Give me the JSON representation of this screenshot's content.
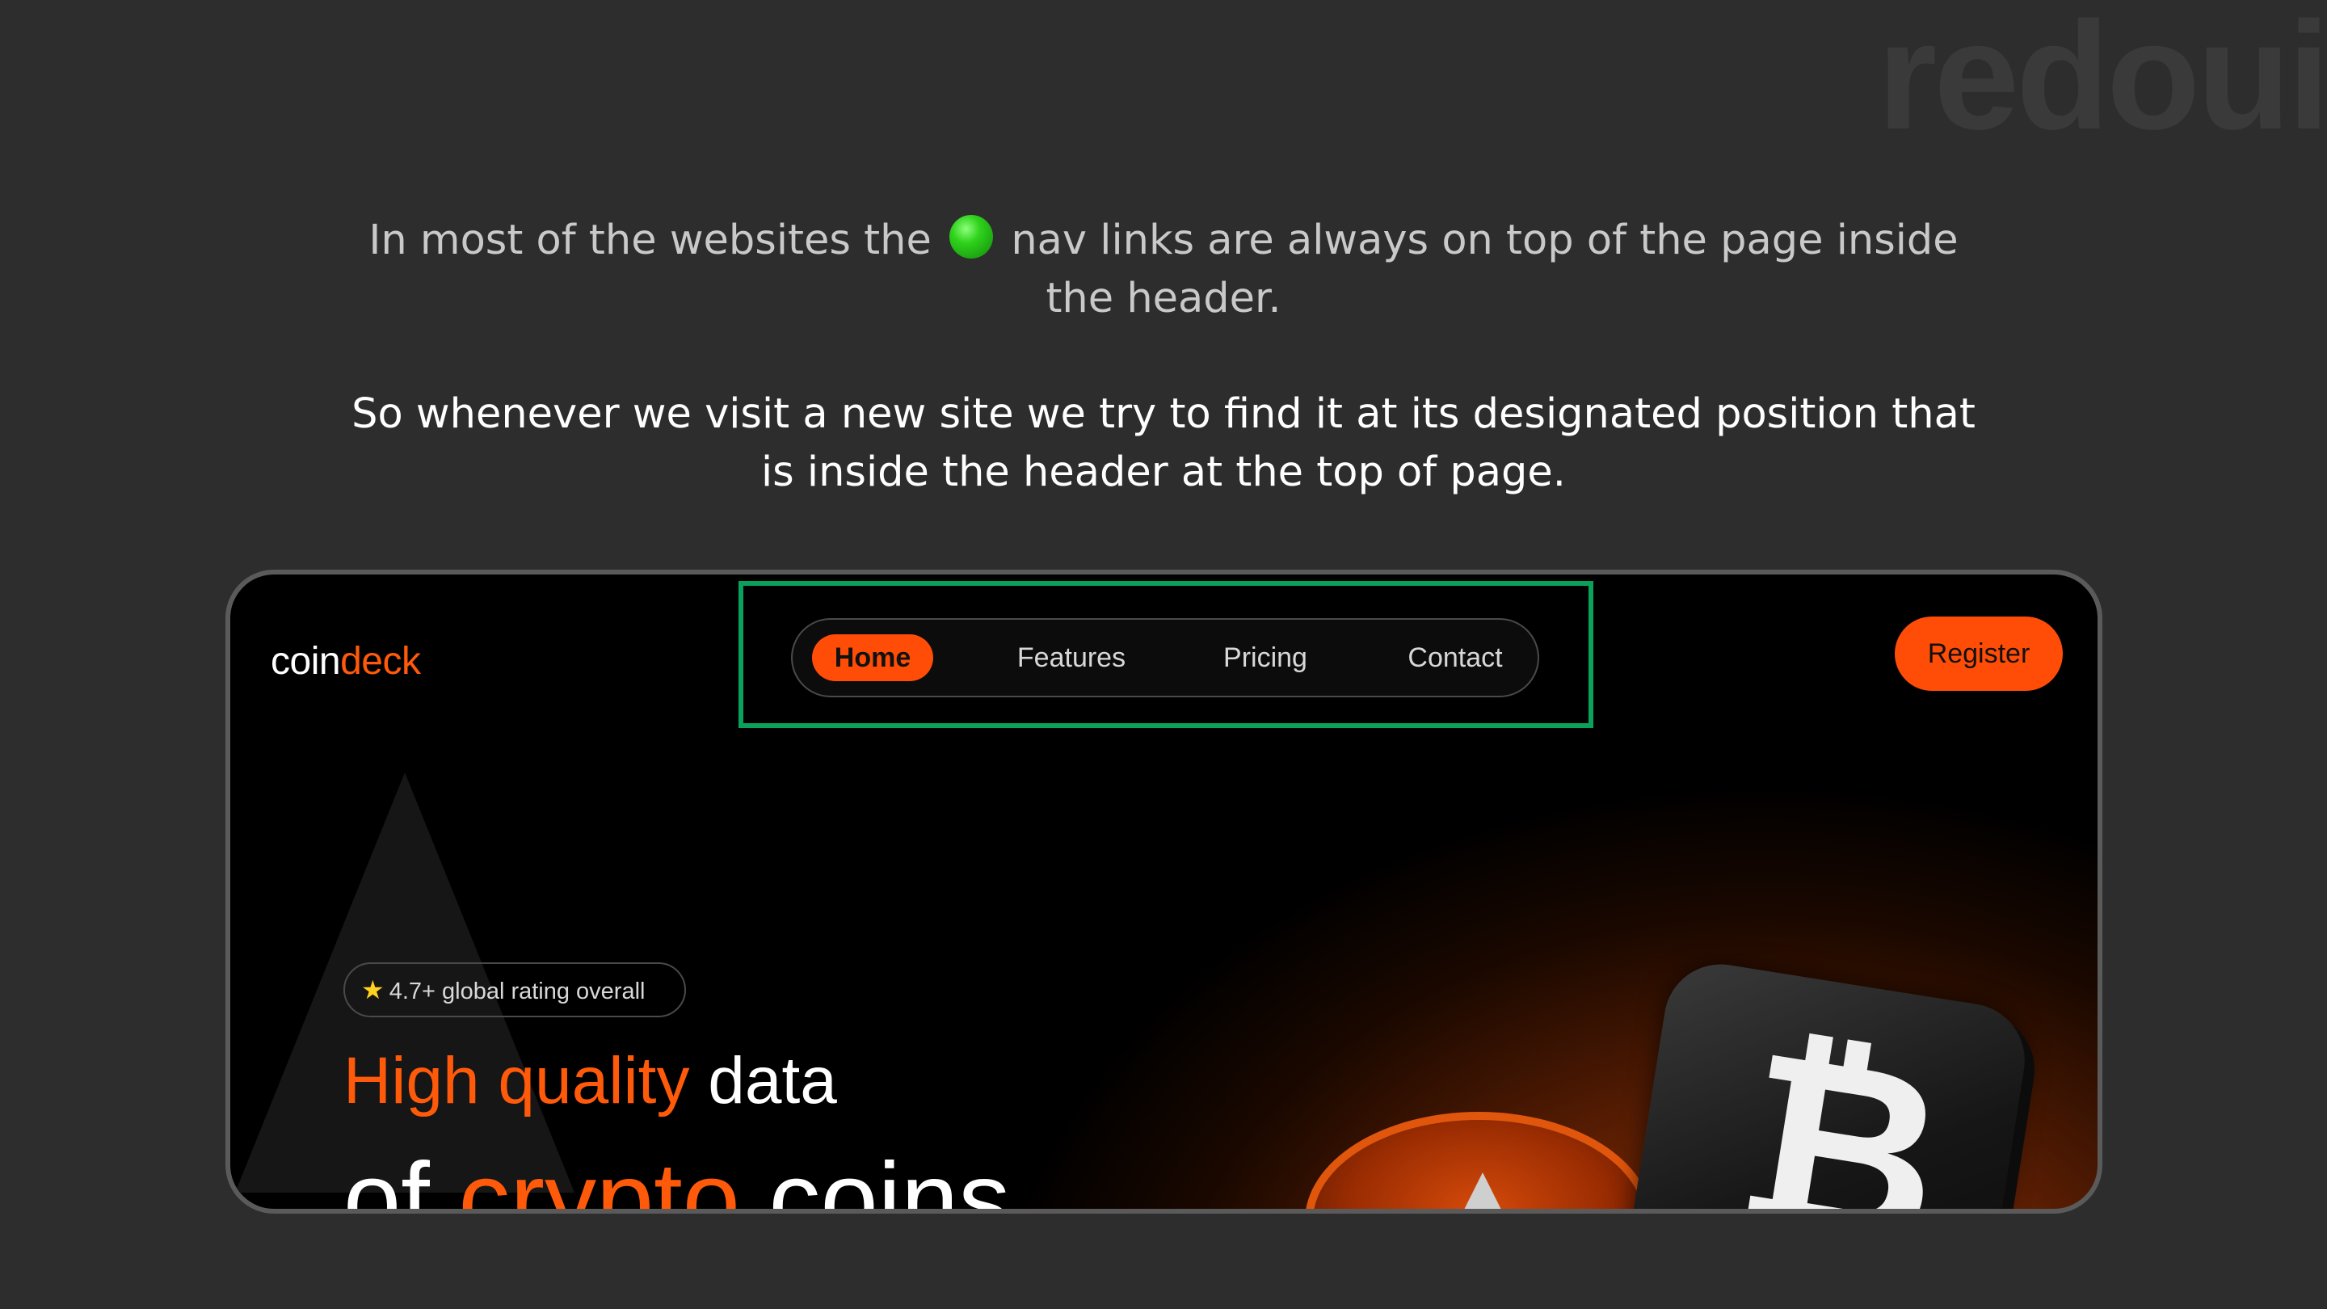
{
  "watermark": "redoui",
  "captions": {
    "first_line1_before": "In most of the websites the",
    "first_line1_after": "nav links are always on top of the page inside",
    "first_line2": "the header.",
    "second_line1": "So whenever we visit a new site we try to find it at its designated position that",
    "second_line2": "is inside the header at the top of page.",
    "dot_icon": "green-circle-icon",
    "dot_color": "#2fd21c"
  },
  "site": {
    "logo_part1": "coin",
    "logo_part2": "deck",
    "nav": [
      "Home",
      "Features",
      "Pricing",
      "Contact"
    ],
    "active_nav": "Home",
    "register_label": "Register",
    "rating_text": "4.7+ global rating overall",
    "rating_icon": "star-icon",
    "headline_orange": "High quality",
    "headline_white": " data",
    "headline2_white1": "of ",
    "headline2_orange": "crypto",
    "headline2_white2": " coins",
    "bitcoin_symbol": "₿",
    "accent_color": "#ff4d07",
    "highlight_color": "#0aa15a"
  }
}
